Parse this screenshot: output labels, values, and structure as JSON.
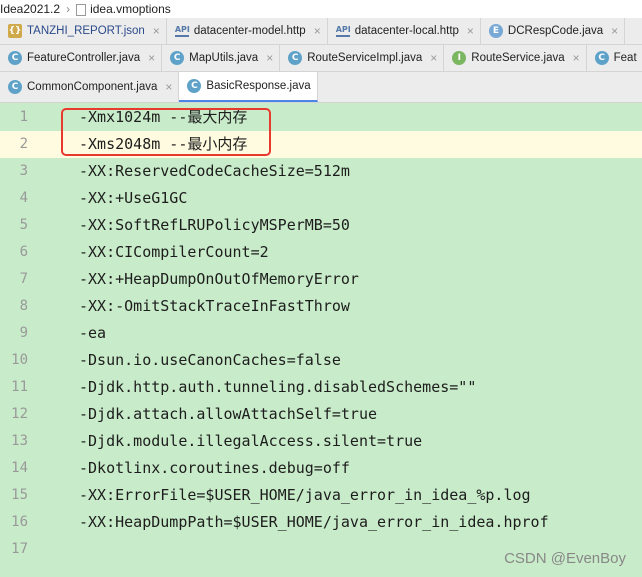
{
  "breadcrumb": {
    "project": "Idea2021.2",
    "file": "idea.vmoptions"
  },
  "tabs_row1": [
    {
      "icon": "json",
      "label": "TANZHI_REPORT.json",
      "red": false
    },
    {
      "icon": "api",
      "label": "datacenter-model.http",
      "red": false
    },
    {
      "icon": "api",
      "label": "datacenter-local.http",
      "red": false
    },
    {
      "icon": "enum",
      "label": "DCRespCode.java",
      "red": false
    }
  ],
  "tabs_row2": [
    {
      "icon": "class",
      "label": "FeatureController.java"
    },
    {
      "icon": "class",
      "label": "MapUtils.java"
    },
    {
      "icon": "class",
      "label": "RouteServiceImpl.java"
    },
    {
      "icon": "interface",
      "label": "RouteService.java"
    },
    {
      "icon": "class",
      "label": "Feat"
    }
  ],
  "tabs_row3": [
    {
      "icon": "class",
      "label": "CommonComponent.java"
    },
    {
      "icon": "class",
      "label": "BasicResponse.java",
      "active": true
    }
  ],
  "editor": {
    "lines": [
      {
        "n": "1",
        "text": "-Xmx1024m --最大内存"
      },
      {
        "n": "2",
        "text": "-Xms2048m --最小内存"
      },
      {
        "n": "3",
        "text": "-XX:ReservedCodeCacheSize=512m"
      },
      {
        "n": "4",
        "text": "-XX:+UseG1GC"
      },
      {
        "n": "5",
        "text": "-XX:SoftRefLRUPolicyMSPerMB=50"
      },
      {
        "n": "6",
        "text": "-XX:CICompilerCount=2"
      },
      {
        "n": "7",
        "text": "-XX:+HeapDumpOnOutOfMemoryError"
      },
      {
        "n": "8",
        "text": "-XX:-OmitStackTraceInFastThrow"
      },
      {
        "n": "9",
        "text": "-ea"
      },
      {
        "n": "10",
        "text": "-Dsun.io.useCanonCaches=false"
      },
      {
        "n": "11",
        "text": "-Djdk.http.auth.tunneling.disabledSchemes=\"\""
      },
      {
        "n": "12",
        "text": "-Djdk.attach.allowAttachSelf=true"
      },
      {
        "n": "13",
        "text": "-Djdk.module.illegalAccess.silent=true"
      },
      {
        "n": "14",
        "text": "-Dkotlinx.coroutines.debug=off"
      },
      {
        "n": "15",
        "text": "-XX:ErrorFile=$USER_HOME/java_error_in_idea_%p.log"
      },
      {
        "n": "16",
        "text": "-XX:HeapDumpPath=$USER_HOME/java_error_in_idea.hprof"
      },
      {
        "n": "17",
        "text": ""
      }
    ],
    "highlighted_line": "2"
  },
  "watermark": "CSDN @EvenBoy",
  "colors": {
    "editor_bg": "#c8ebc9",
    "current_line": "#fffbe0",
    "annotation_box": "#e8392e"
  }
}
